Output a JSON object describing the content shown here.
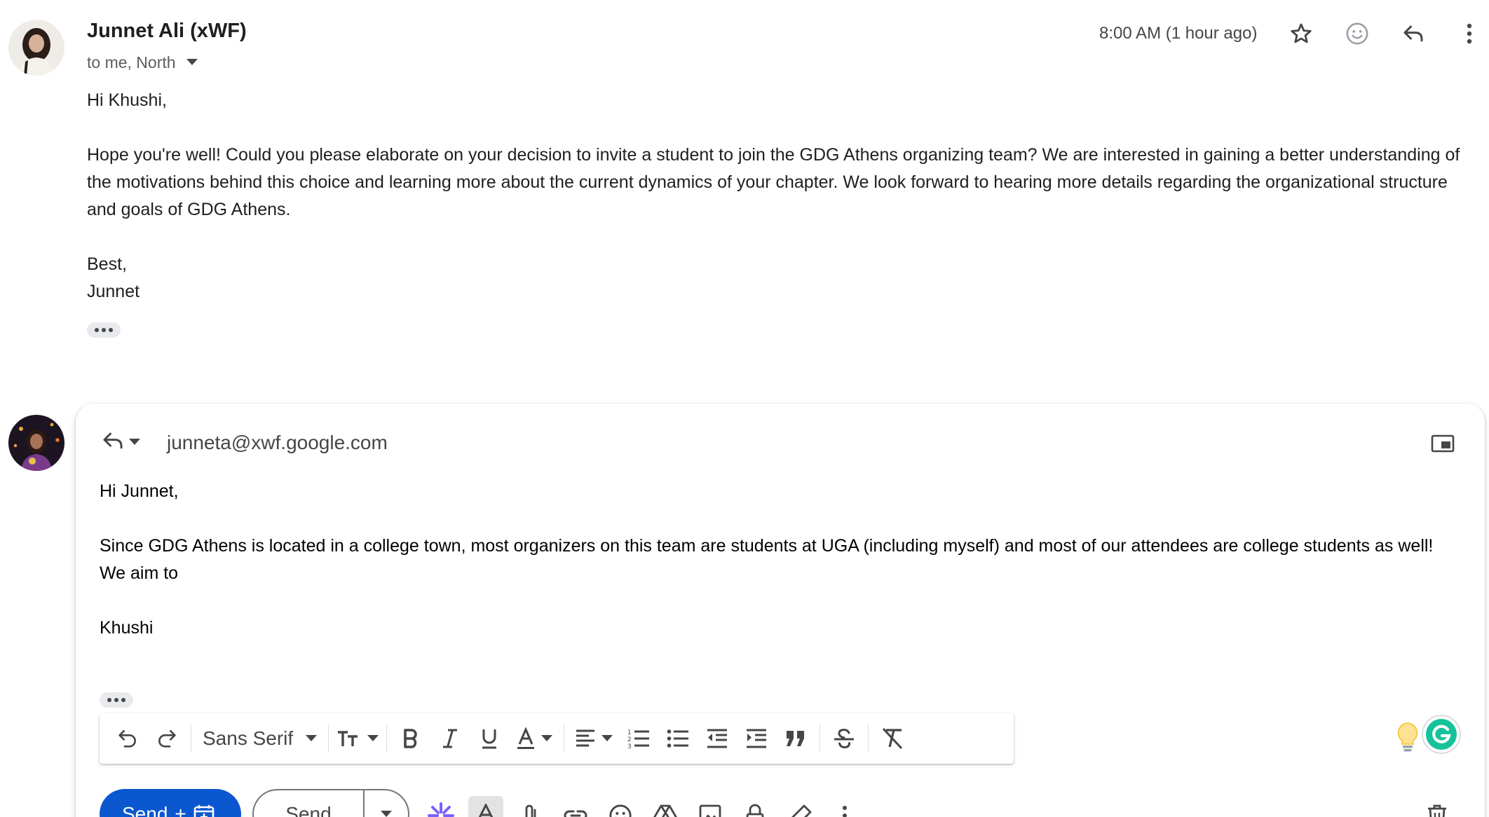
{
  "message": {
    "sender_name": "Junnet Ali (xWF)",
    "recipients": "to me, North",
    "timestamp": "8:00 AM (1 hour ago)",
    "icons": [
      "star-icon",
      "emoji-icon",
      "reply-icon",
      "more-vert-icon"
    ],
    "body": {
      "greeting": "Hi Khushi,",
      "paragraph": "Hope you're well! Could you please elaborate on your decision to invite a student to join the GDG Athens organizing team? We are interested in gaining a better understanding of the motivations behind this choice and learning more about the current dynamics of your chapter. We look forward to hearing more details regarding the organizational structure and goals of GDG Athens.",
      "closing": "Best,",
      "signature": "Junnet"
    }
  },
  "reply": {
    "to_address": "junneta@xwf.google.com",
    "body": {
      "greeting": "Hi Junnet,",
      "paragraph": "Since GDG Athens is located in a college town, most organizers on this team are students at UGA (including myself) and most of our attendees are college students as well! We aim to",
      "signature": "Khushi"
    },
    "toolbar": {
      "font_family": "Sans Serif",
      "buttons": [
        "undo",
        "redo",
        "font-size",
        "bold",
        "italic",
        "underline",
        "text-color",
        "align",
        "numbered-list",
        "bulleted-list",
        "indent-less",
        "indent-more",
        "quote",
        "strikethrough",
        "remove-formatting"
      ]
    },
    "actions": {
      "send_label": "Send",
      "send_suffix": "+",
      "send_later_label": "Send"
    }
  },
  "colors": {
    "accent": "#0b57d0",
    "text": "#1f1f1f",
    "secondary_text": "#444746",
    "grammarly": "#15c39a"
  }
}
